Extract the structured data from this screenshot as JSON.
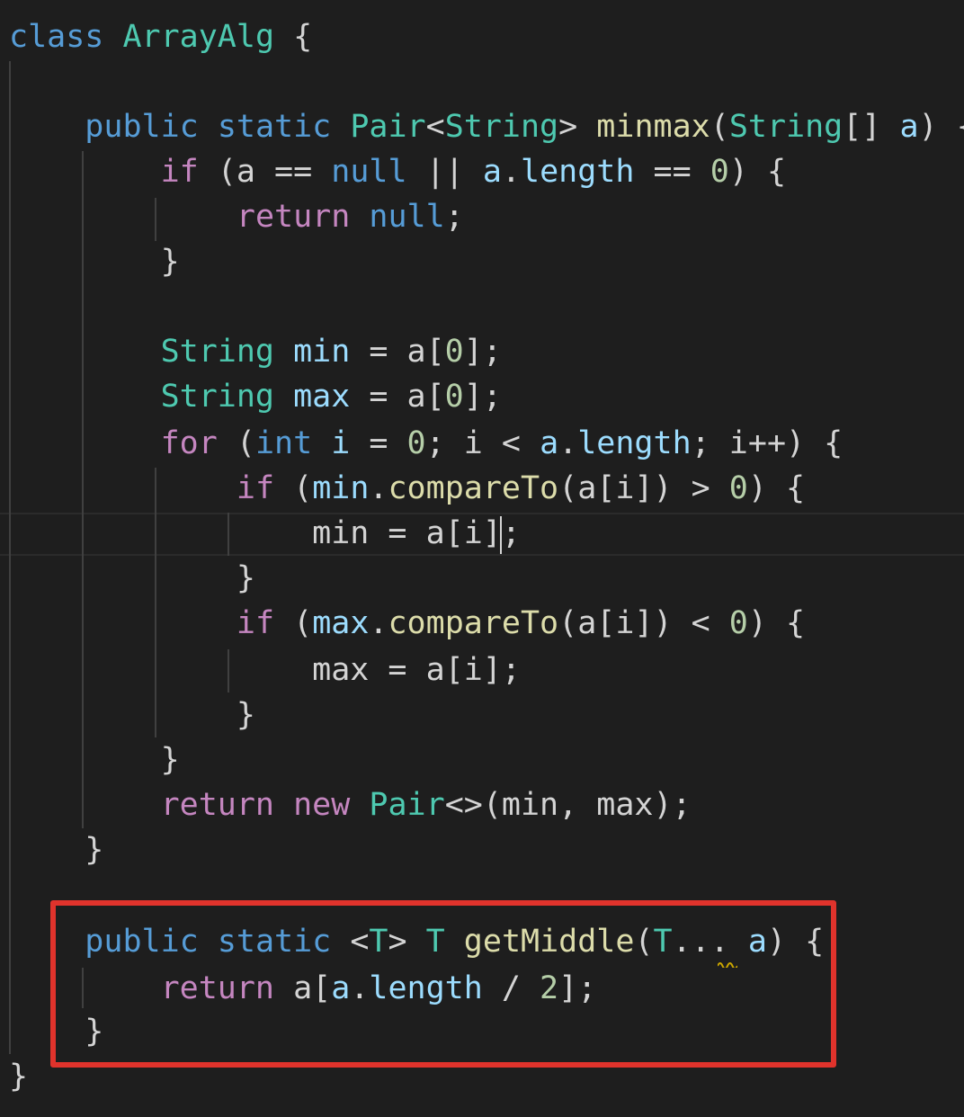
{
  "editor": {
    "colors": {
      "background": "#1e1e1e",
      "keyword_blue": "#569cd6",
      "keyword_control": "#c586c0",
      "type_teal": "#4ec9b0",
      "function_yellow": "#dcdcaa",
      "variable_blue": "#9cdcfe",
      "number_green": "#b5cea8",
      "plain_text": "#d4d4d4",
      "highlight_box": "#e0332c",
      "warning_squiggle": "#cca700"
    },
    "lines": [
      {
        "tokens": [
          [
            "class",
            "kw"
          ],
          [
            " ",
            "p"
          ],
          [
            "ArrayAlg",
            "ty"
          ],
          [
            " {",
            "p"
          ]
        ]
      },
      {
        "tokens": []
      },
      {
        "tokens": [
          [
            "    ",
            "p"
          ],
          [
            "public",
            "kw"
          ],
          [
            " ",
            "p"
          ],
          [
            "static",
            "kw"
          ],
          [
            " ",
            "p"
          ],
          [
            "Pair",
            "ty"
          ],
          [
            "<",
            "p"
          ],
          [
            "String",
            "ty"
          ],
          [
            "> ",
            "p"
          ],
          [
            "minmax",
            "fn"
          ],
          [
            "(",
            "p"
          ],
          [
            "String",
            "ty"
          ],
          [
            "[] ",
            "p"
          ],
          [
            "a",
            "var"
          ],
          [
            ") {",
            "p"
          ]
        ]
      },
      {
        "tokens": [
          [
            "        ",
            "p"
          ],
          [
            "if",
            "ctl"
          ],
          [
            " (a == ",
            "p"
          ],
          [
            "null",
            "kw"
          ],
          [
            " || ",
            "p"
          ],
          [
            "a",
            "var"
          ],
          [
            ".",
            "p"
          ],
          [
            "length",
            "var"
          ],
          [
            " == ",
            "p"
          ],
          [
            "0",
            "num"
          ],
          [
            ") {",
            "p"
          ]
        ]
      },
      {
        "tokens": [
          [
            "            ",
            "p"
          ],
          [
            "return",
            "ctl"
          ],
          [
            " ",
            "p"
          ],
          [
            "null",
            "kw"
          ],
          [
            ";",
            "p"
          ]
        ]
      },
      {
        "tokens": [
          [
            "        }",
            "p"
          ]
        ]
      },
      {
        "tokens": []
      },
      {
        "tokens": [
          [
            "        ",
            "p"
          ],
          [
            "String",
            "ty"
          ],
          [
            " ",
            "p"
          ],
          [
            "min",
            "var"
          ],
          [
            " = a[",
            "p"
          ],
          [
            "0",
            "num"
          ],
          [
            "];",
            "p"
          ]
        ]
      },
      {
        "tokens": [
          [
            "        ",
            "p"
          ],
          [
            "String",
            "ty"
          ],
          [
            " ",
            "p"
          ],
          [
            "max",
            "var"
          ],
          [
            " = a[",
            "p"
          ],
          [
            "0",
            "num"
          ],
          [
            "];",
            "p"
          ]
        ]
      },
      {
        "tokens": [
          [
            "        ",
            "p"
          ],
          [
            "for",
            "ctl"
          ],
          [
            " (",
            "p"
          ],
          [
            "int",
            "kw"
          ],
          [
            " ",
            "p"
          ],
          [
            "i",
            "var"
          ],
          [
            " = ",
            "p"
          ],
          [
            "0",
            "num"
          ],
          [
            "; i < ",
            "p"
          ],
          [
            "a",
            "var"
          ],
          [
            ".",
            "p"
          ],
          [
            "length",
            "var"
          ],
          [
            "; i++) {",
            "p"
          ]
        ]
      },
      {
        "tokens": [
          [
            "            ",
            "p"
          ],
          [
            "if",
            "ctl"
          ],
          [
            " (",
            "p"
          ],
          [
            "min",
            "var"
          ],
          [
            ".",
            "p"
          ],
          [
            "compareTo",
            "fn"
          ],
          [
            "(a[i]) > ",
            "p"
          ],
          [
            "0",
            "num"
          ],
          [
            ") {",
            "p"
          ]
        ]
      },
      {
        "tokens": [
          [
            "                min = a[i];",
            "p"
          ]
        ]
      },
      {
        "tokens": [
          [
            "            }",
            "p"
          ]
        ]
      },
      {
        "tokens": [
          [
            "            ",
            "p"
          ],
          [
            "if",
            "ctl"
          ],
          [
            " (",
            "p"
          ],
          [
            "max",
            "var"
          ],
          [
            ".",
            "p"
          ],
          [
            "compareTo",
            "fn"
          ],
          [
            "(a[i]) < ",
            "p"
          ],
          [
            "0",
            "num"
          ],
          [
            ") {",
            "p"
          ]
        ]
      },
      {
        "tokens": [
          [
            "                max = a[i];",
            "p"
          ]
        ]
      },
      {
        "tokens": [
          [
            "            }",
            "p"
          ]
        ]
      },
      {
        "tokens": [
          [
            "        }",
            "p"
          ]
        ]
      },
      {
        "tokens": [
          [
            "        ",
            "p"
          ],
          [
            "return",
            "ctl"
          ],
          [
            " ",
            "p"
          ],
          [
            "new",
            "ctl"
          ],
          [
            " ",
            "p"
          ],
          [
            "Pair",
            "ty"
          ],
          [
            "<>(min, max);",
            "p"
          ]
        ]
      },
      {
        "tokens": [
          [
            "    }",
            "p"
          ]
        ]
      },
      {
        "tokens": []
      },
      {
        "tokens": [
          [
            "    ",
            "p"
          ],
          [
            "public",
            "kw"
          ],
          [
            " ",
            "p"
          ],
          [
            "static",
            "kw"
          ],
          [
            " <",
            "p"
          ],
          [
            "T",
            "ty"
          ],
          [
            "> ",
            "p"
          ],
          [
            "T",
            "ty"
          ],
          [
            " ",
            "p"
          ],
          [
            "getMiddle",
            "fn"
          ],
          [
            "(",
            "p"
          ],
          [
            "T",
            "ty"
          ],
          [
            "... ",
            "p"
          ],
          [
            "a",
            "var"
          ],
          [
            ") {",
            "p"
          ]
        ]
      },
      {
        "tokens": [
          [
            "        ",
            "p"
          ],
          [
            "return",
            "ctl"
          ],
          [
            " a[",
            "p"
          ],
          [
            "a",
            "var"
          ],
          [
            ".",
            "p"
          ],
          [
            "length",
            "var"
          ],
          [
            " / ",
            "p"
          ],
          [
            "2",
            "num"
          ],
          [
            "];",
            "p"
          ]
        ]
      },
      {
        "tokens": [
          [
            "    }",
            "p"
          ]
        ]
      },
      {
        "tokens": [
          [
            "}",
            "p"
          ]
        ]
      }
    ]
  }
}
